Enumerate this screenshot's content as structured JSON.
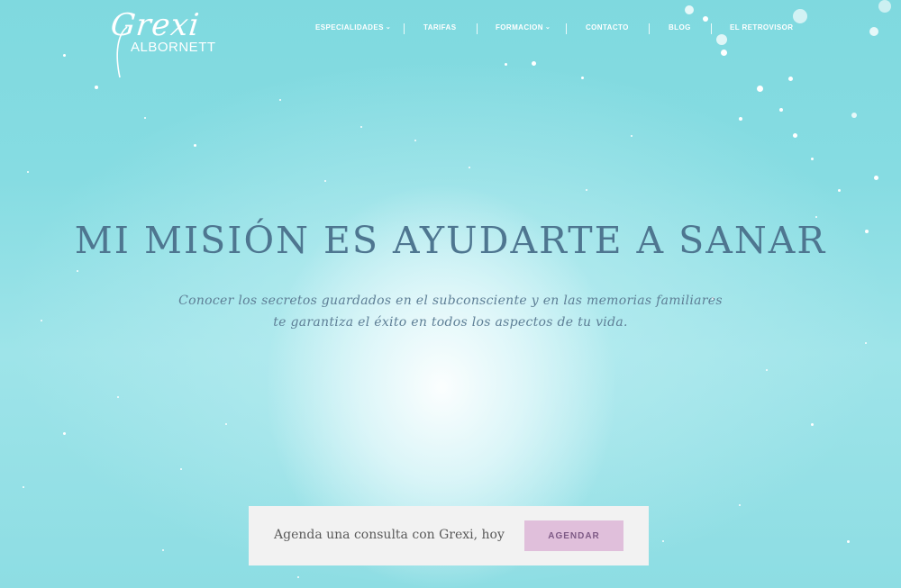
{
  "brand": {
    "script": "Grexi",
    "sub": "ALBORNETT"
  },
  "nav": {
    "items": [
      {
        "label": "ESPECIALIDADES",
        "has_dropdown": true
      },
      {
        "label": "TARIFAS",
        "has_dropdown": false
      },
      {
        "label": "FORMACION",
        "has_dropdown": true
      },
      {
        "label": "CONTACTO",
        "has_dropdown": false
      },
      {
        "label": "BLOG",
        "has_dropdown": false
      },
      {
        "label": "EL RETROVISOR",
        "has_dropdown": false
      }
    ]
  },
  "hero": {
    "title": "MI MISIÓN ES AYUDARTE A SANAR",
    "subtitle_line1": "Conocer los secretos guardados en el subconsciente y en las memorias familiares",
    "subtitle_line2": "te garantiza el éxito en todos los aspectos de tu vida."
  },
  "cta": {
    "text": "Agenda una consulta con Grexi, hoy",
    "button_label": "AGENDAR"
  },
  "colors": {
    "background_teal": "#86dce2",
    "title": "#4e7690",
    "subtitle": "#5e7f96",
    "cta_box": "#f2f2f2",
    "cta_button": "#e0bfdb",
    "cta_button_text": "#7e5a86"
  }
}
